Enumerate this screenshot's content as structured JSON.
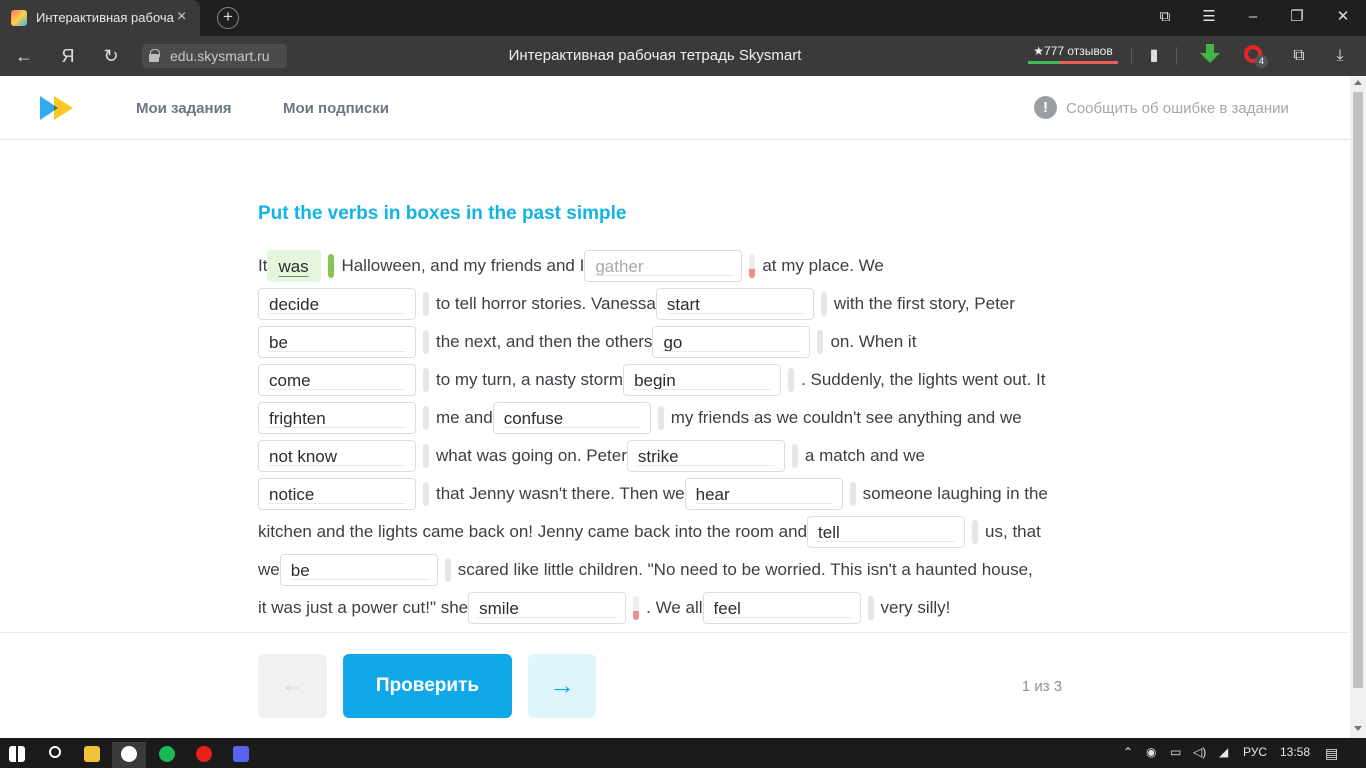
{
  "browser": {
    "tab_title": "Интерактивная рабоча",
    "tab_close": "×",
    "new_tab": "+",
    "url": "edu.skysmart.ru",
    "page_title": "Интерактивная рабочая тетрадь Skysmart",
    "reviews_label": "★777 отзывов",
    "reviews_positive_fraction": 0.35,
    "extension_badge": "4",
    "nav_back": "←",
    "nav_home": "Я",
    "nav_reload": "↻"
  },
  "site": {
    "nav": [
      "Мои задания",
      "Мои подписки"
    ],
    "report_label": "Сообщить об ошибке в задании",
    "report_icon": "!"
  },
  "exercise": {
    "title": "Put the verbs in boxes in the past simple",
    "lines": [
      [
        {
          "text": "It "
        },
        {
          "gap": "was",
          "state": "correct",
          "w": 54
        },
        {
          "text": "Halloween, and my friends and I "
        },
        {
          "gap": "gather",
          "state": "hint",
          "w": 158,
          "ind": "error"
        },
        {
          "text": "at my place. We"
        }
      ],
      [
        {
          "gap": "decide",
          "w": 158
        },
        {
          "text": "to tell horror stories. Vanessa "
        },
        {
          "gap": "start",
          "w": 158
        },
        {
          "text": "with the first story, Peter"
        }
      ],
      [
        {
          "gap": "be",
          "w": 158
        },
        {
          "text": "the next, and then the others "
        },
        {
          "gap": "go",
          "w": 158
        },
        {
          "text": "on. When it"
        }
      ],
      [
        {
          "gap": "come",
          "w": 158
        },
        {
          "text": "to my turn, a nasty storm "
        },
        {
          "gap": "begin",
          "w": 158
        },
        {
          "text": ". Suddenly, the lights went out. It"
        }
      ],
      [
        {
          "gap": "frighten",
          "w": 158
        },
        {
          "text": "me and "
        },
        {
          "gap": "confuse",
          "w": 158
        },
        {
          "text": "my friends as we couldn't see anything and we"
        }
      ],
      [
        {
          "gap": "not know",
          "w": 158
        },
        {
          "text": "what was going on. Peter "
        },
        {
          "gap": "strike",
          "w": 158
        },
        {
          "text": "a match and we"
        }
      ],
      [
        {
          "gap": "notice",
          "w": 158
        },
        {
          "text": "that Jenny wasn't there. Then we "
        },
        {
          "gap": "hear",
          "w": 158
        },
        {
          "text": "someone laughing in the"
        }
      ],
      [
        {
          "text": "kitchen and the lights came back on! Jenny came back into the room and "
        },
        {
          "gap": "tell",
          "w": 158
        },
        {
          "text": "us, that"
        }
      ],
      [
        {
          "text": "we "
        },
        {
          "gap": "be",
          "w": 158
        },
        {
          "text": "scared like little children. \"No need to be worried. This isn't a haunted house,"
        }
      ],
      [
        {
          "text": "it was just a power cut!\" she "
        },
        {
          "gap": "smile",
          "w": 158,
          "ind": "error"
        },
        {
          "text": ". We all "
        },
        {
          "gap": "feel",
          "w": 158
        },
        {
          "text": "very silly!"
        }
      ]
    ]
  },
  "footer": {
    "prev_label": "←",
    "check_label": "Проверить",
    "next_label": "→",
    "page_counter": "1 из 3"
  },
  "taskbar": {
    "language": "РУС",
    "time": "13:58"
  }
}
